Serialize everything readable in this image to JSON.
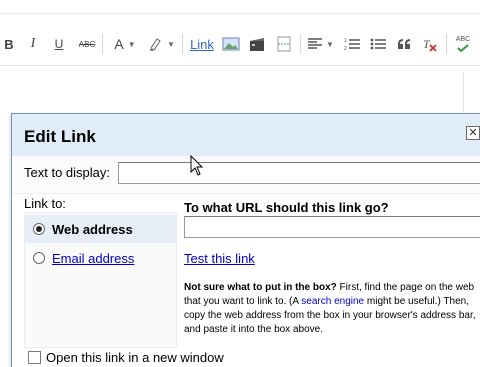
{
  "toolbar": {
    "bold": "B",
    "italic": "I",
    "underline": "U",
    "strikethrough": "ABC",
    "font_color": "A",
    "link": "Link",
    "spellcheck": "ABC"
  },
  "dialog": {
    "title": "Edit Link",
    "close_glyph": "✕",
    "text_to_display_label": "Text to display:",
    "text_to_display_value": "",
    "link_to_label": "Link to:",
    "options": [
      {
        "label": "Web address",
        "selected": true
      },
      {
        "label": "Email address",
        "selected": false
      }
    ],
    "url_question": "To what URL should this link go?",
    "url_value": "",
    "test_link": "Test this link",
    "help_bold": "Not sure what to put in the box?",
    "help_pre": " First, find the page on the web that you want to link to. (A ",
    "help_link": "search engine",
    "help_post": " might be useful.) Then, copy the web address from the box in your browser's address bar, and paste it into the box above.",
    "new_window_label": "Open this link in a new window",
    "new_window_checked": false
  },
  "colors": {
    "header_bg": "#e0ecf8",
    "link_blue": "#0000cc",
    "toolbar_link": "#3366cc",
    "spellcheck_green": "#3c9a3c",
    "remove_format_red": "#cc2222"
  },
  "icons": [
    "bold-icon",
    "italic-icon",
    "underline-icon",
    "strikethrough-icon",
    "font-color-icon",
    "highlight-icon",
    "image-icon",
    "video-icon",
    "jump-break-icon",
    "align-icon",
    "numbered-list-icon",
    "bulleted-list-icon",
    "quote-icon",
    "remove-formatting-icon",
    "spellcheck-icon",
    "mouse-cursor-icon"
  ]
}
